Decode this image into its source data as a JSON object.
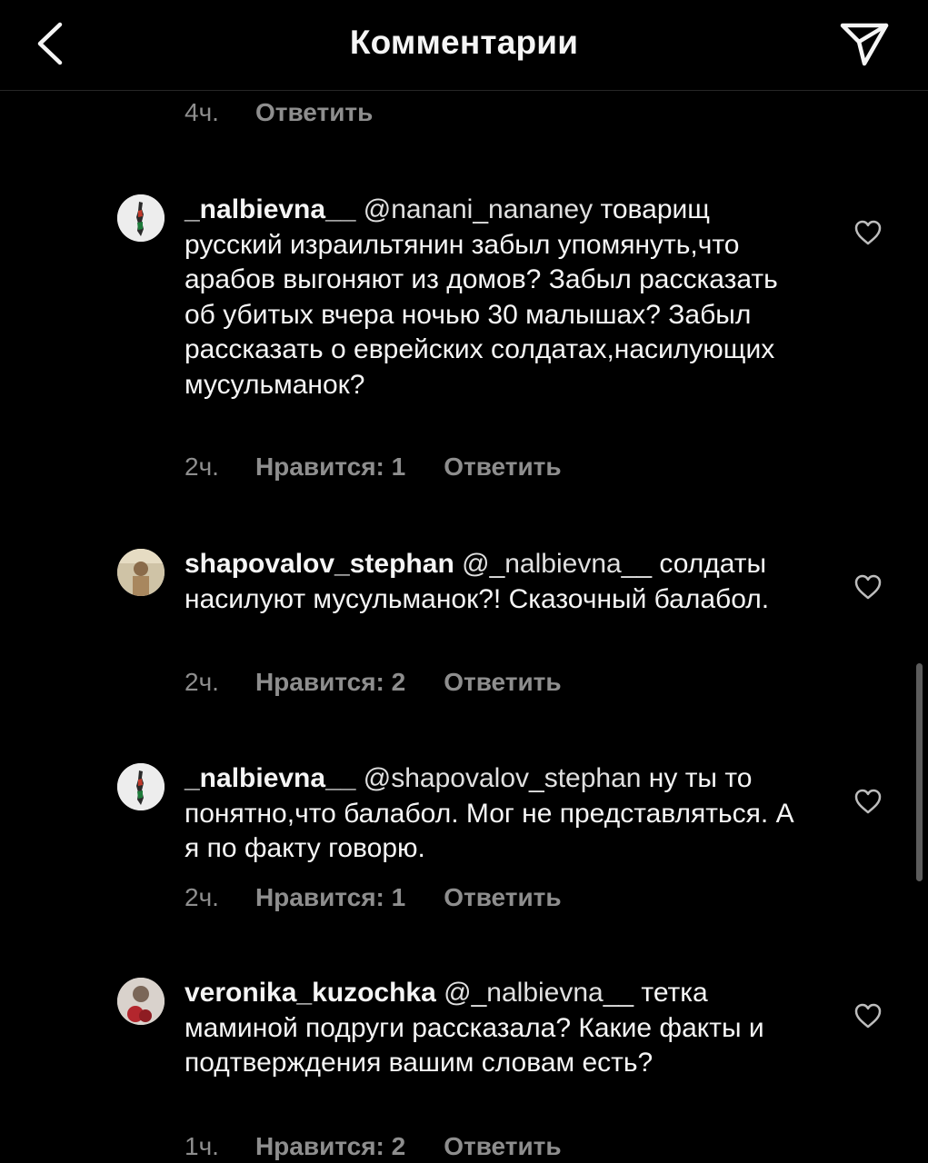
{
  "header": {
    "title": "Комментарии"
  },
  "top_comment": {
    "time": "4ч.",
    "reply": "Ответить"
  },
  "comments": [
    {
      "username": "_nalbievna__",
      "mention": "@nanani_nananey",
      "text": " товарищ русский израильтянин забыл упомянуть,что арабов выгоняют из домов? Забыл рассказать об убитых вчера ночью 30 малышах? Забыл рассказать о еврейских солдатах,насилующих мусульманок?",
      "time": "2ч.",
      "likes": "Нравится: 1",
      "reply": "Ответить"
    },
    {
      "username": "shapovalov_stephan",
      "mention": "@_nalbievna__",
      "text": " солдаты насилуют мусульманок?! Сказочный балабол.",
      "time": "2ч.",
      "likes": "Нравится: 2",
      "reply": "Ответить"
    },
    {
      "username": "_nalbievna__",
      "mention": "@shapovalov_stephan",
      "text": " ну ты то понятно,что балабол. Мог не представляться. А я по факту говорю.",
      "time": "2ч.",
      "likes": "Нравится: 1",
      "reply": "Ответить"
    },
    {
      "username": "veronika_kuzochka",
      "mention": "@_nalbievna__",
      "text": " тетка маминой подруги рассказала? Какие факты и подтверждения вашим словам есть?",
      "time": "1ч.",
      "likes": "Нравится: 2",
      "reply": "Ответить"
    }
  ],
  "icons": {
    "back": "chevron-left-icon",
    "share": "paper-plane-icon",
    "like": "heart-outline-icon"
  },
  "colors": {
    "background": "#000000",
    "text": "#f5f5f5",
    "meta": "#8e8e8e",
    "divider": "#262626"
  }
}
